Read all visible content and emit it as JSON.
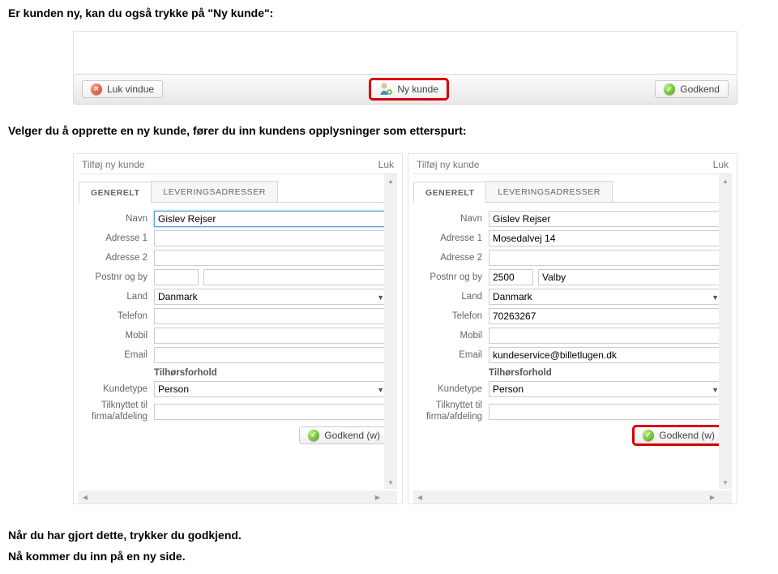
{
  "intro": "Er kunden ny, kan du også trykke på \"Ny kunde\":",
  "toolbar": {
    "close": "Luk vindue",
    "new_customer": "Ny kunde",
    "approve": "Godkend"
  },
  "mid_text": "Velger du å opprette en ny kunde, fører du inn kundens opplysninger som etterspurt:",
  "panel": {
    "title": "Tilføj ny kunde",
    "close": "Luk",
    "tabs": {
      "general": "GENERELT",
      "delivery": "LEVERINGSADRESSER"
    },
    "labels": {
      "navn": "Navn",
      "adresse1": "Adresse 1",
      "adresse2": "Adresse 2",
      "postnr": "Postnr og by",
      "land": "Land",
      "telefon": "Telefon",
      "mobil": "Mobil",
      "email": "Email",
      "tilhors": "Tilhørsforhold",
      "kundetype": "Kundetype",
      "tilknyttet": "Tilknyttet til firma/afdeling"
    },
    "approve_w": "Godkend (w)"
  },
  "left_values": {
    "navn": "Gislev Rejser",
    "adresse1": "",
    "adresse2": "",
    "postnr": "",
    "by": "",
    "land": "Danmark",
    "telefon": "",
    "mobil": "",
    "email": "",
    "kundetype": "Person",
    "tilknyttet": ""
  },
  "right_values": {
    "navn": "Gislev Rejser",
    "adresse1": "Mosedalvej 14",
    "adresse2": "",
    "postnr": "2500",
    "by": "Valby",
    "land": "Danmark",
    "telefon": "70263267",
    "mobil": "",
    "email": "kundeservice@billetlugen.dk",
    "kundetype": "Person",
    "tilknyttet": ""
  },
  "outro1": "Når du har gjort dette, trykker du godkjend.",
  "outro2": "Nå kommer du inn på en ny side."
}
